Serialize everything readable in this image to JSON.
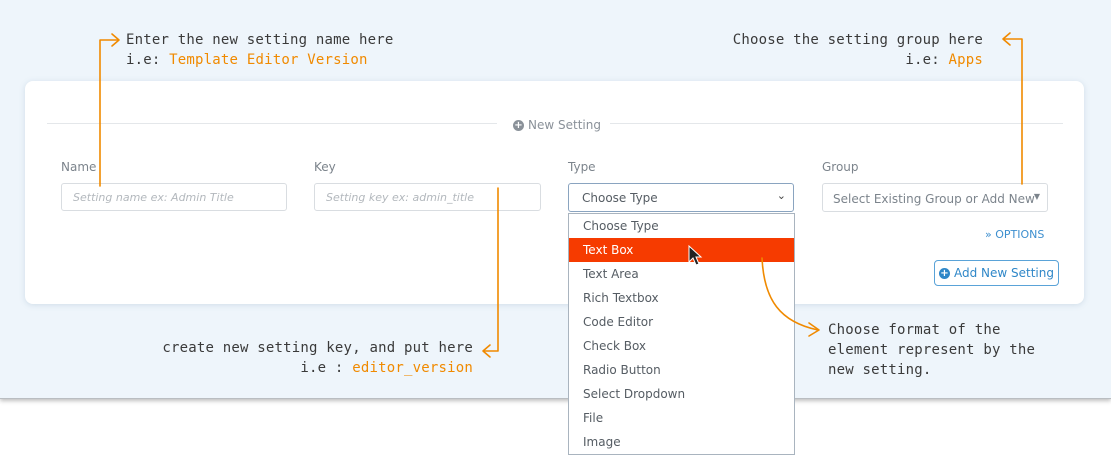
{
  "annotations": {
    "name_note": {
      "line1": "Enter the new setting name here",
      "prefix": "i.e: ",
      "example": "Template Editor Version"
    },
    "group_note": {
      "line1": "Choose the setting group here",
      "prefix": "i.e: ",
      "example": "Apps"
    },
    "key_note": {
      "line1": "create new setting key, and put here",
      "prefix": "i.e : ",
      "example": "editor_version"
    },
    "type_note": {
      "line1": "Choose format of the",
      "line2": "element represent by the",
      "line3": "new setting."
    }
  },
  "form": {
    "section_title": "New Setting",
    "name": {
      "label": "Name",
      "placeholder": "Setting name ex: Admin Title"
    },
    "key": {
      "label": "Key",
      "placeholder": "Setting key ex: admin_title"
    },
    "type": {
      "label": "Type",
      "value": "Choose Type"
    },
    "group": {
      "label": "Group",
      "placeholder": "Select Existing Group or Add New"
    },
    "options_label": "OPTIONS",
    "add_button_label": "Add New Setting"
  },
  "dropdown": {
    "items": [
      "Choose Type",
      "Text Box",
      "Text Area",
      "Rich Textbox",
      "Code Editor",
      "Check Box",
      "Radio Button",
      "Select Dropdown",
      "File",
      "Image"
    ],
    "selected": "Text Box"
  },
  "colors": {
    "accent_orange": "#f08a00",
    "selected_item": "#f63b00",
    "link_blue": "#3d8fcf"
  }
}
